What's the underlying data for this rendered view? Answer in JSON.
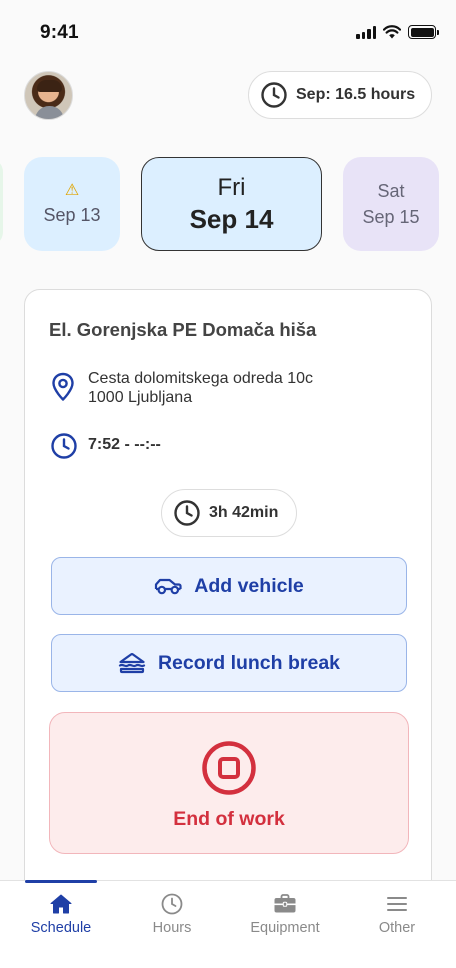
{
  "status_bar": {
    "time": "9:41"
  },
  "header": {
    "hours_label": "Sep: 16.5 hours"
  },
  "days": [
    {
      "date": "Sep 13",
      "warning_icon": "warning-icon"
    },
    {
      "day": "Fri",
      "date": "Sep 14",
      "selected": true
    },
    {
      "day": "Sat",
      "date": "Sep 15"
    }
  ],
  "job": {
    "title": "El. Gorenjska PE Domača hiša",
    "address_line1": "Cesta dolomitskega odreda 10c",
    "address_line2": "1000 Ljubljana",
    "time_range": "7:52 - --:--",
    "duration": "3h 42min",
    "add_vehicle_label": "Add vehicle",
    "lunch_break_label": "Record lunch break",
    "end_work_label": "End of work"
  },
  "tabs": [
    {
      "label": "Schedule",
      "icon": "home-icon",
      "active": true
    },
    {
      "label": "Hours",
      "icon": "clock-icon"
    },
    {
      "label": "Equipment",
      "icon": "toolbox-icon"
    },
    {
      "label": "Other",
      "icon": "menu-icon"
    }
  ],
  "colors": {
    "accent": "#1f3fa6",
    "danger": "#d3303e",
    "selected_day_bg": "#dcefff",
    "sat_bg": "#e8e3f7"
  }
}
